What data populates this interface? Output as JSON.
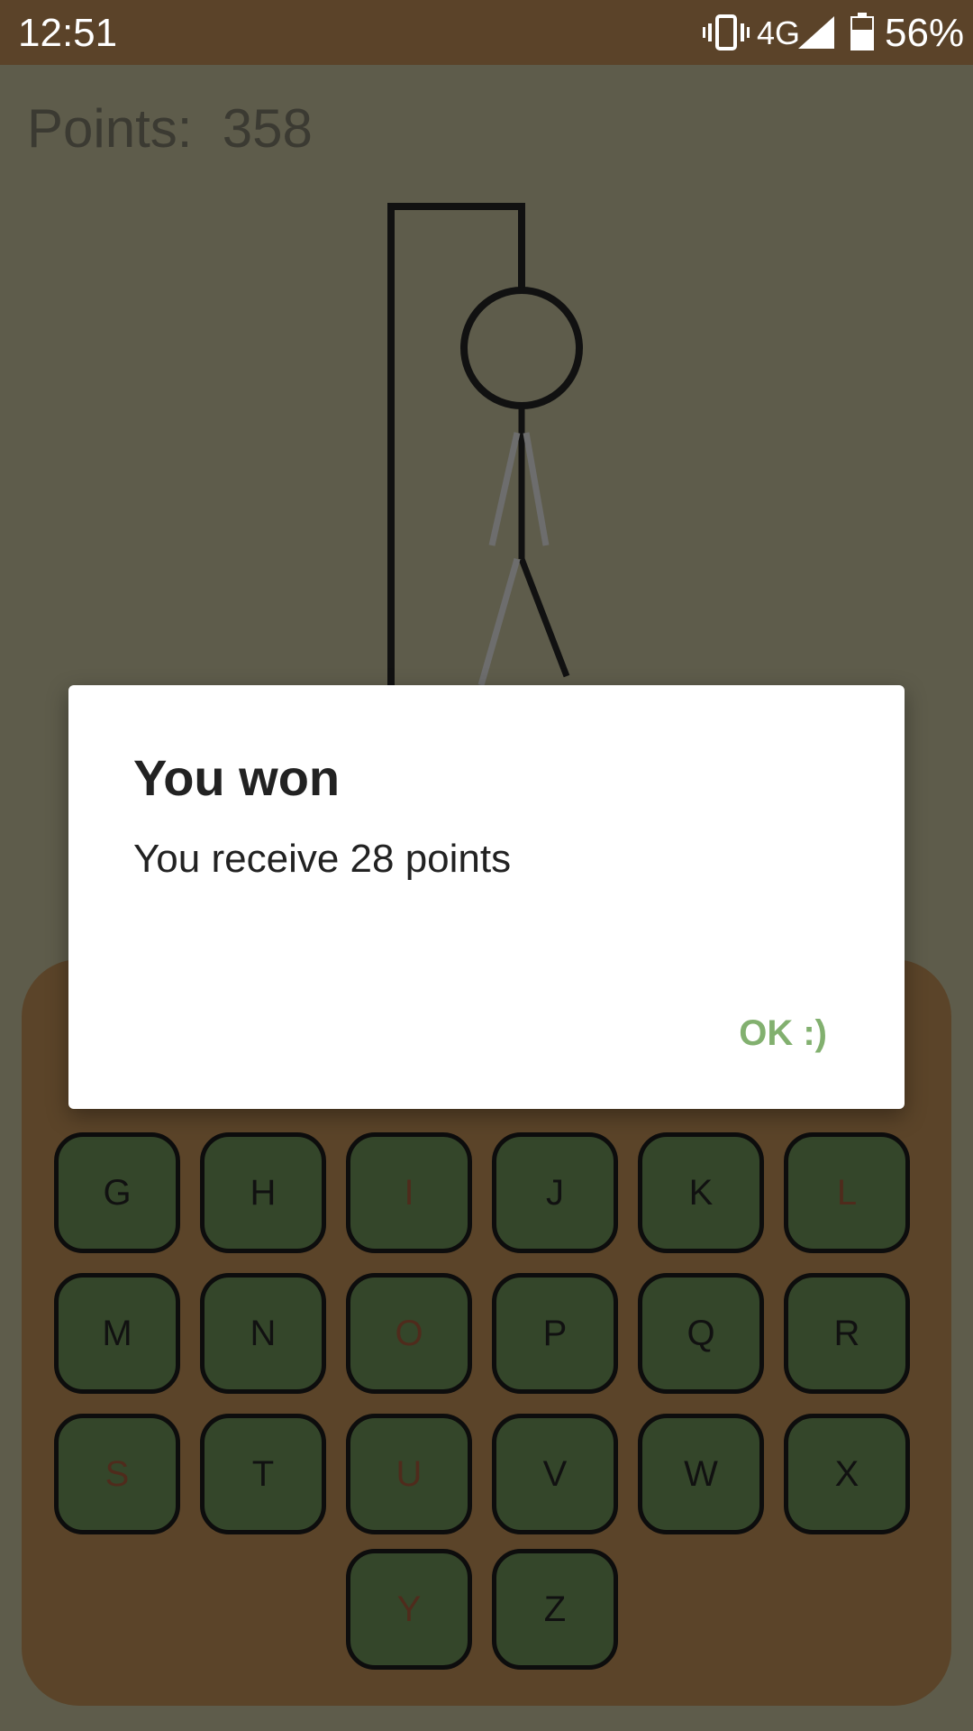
{
  "status_bar": {
    "time": "12:51",
    "network": "4G",
    "battery": "56%",
    "icons": [
      "vibrate-icon",
      "cell-signal-icon",
      "battery-icon"
    ]
  },
  "game": {
    "points_label": "Points:",
    "points_value": "358"
  },
  "keyboard": {
    "keys": [
      {
        "letter": "G",
        "used": false
      },
      {
        "letter": "H",
        "used": false
      },
      {
        "letter": "I",
        "used": true
      },
      {
        "letter": "J",
        "used": false
      },
      {
        "letter": "K",
        "used": false
      },
      {
        "letter": "L",
        "used": true
      },
      {
        "letter": "M",
        "used": false
      },
      {
        "letter": "N",
        "used": false
      },
      {
        "letter": "O",
        "used": true
      },
      {
        "letter": "P",
        "used": false
      },
      {
        "letter": "Q",
        "used": false
      },
      {
        "letter": "R",
        "used": false
      },
      {
        "letter": "S",
        "used": true
      },
      {
        "letter": "T",
        "used": false
      },
      {
        "letter": "U",
        "used": true
      },
      {
        "letter": "V",
        "used": false
      },
      {
        "letter": "W",
        "used": false
      },
      {
        "letter": "X",
        "used": false
      },
      {
        "letter": "Y",
        "used": true
      },
      {
        "letter": "Z",
        "used": false
      }
    ]
  },
  "dialog": {
    "title": "You won",
    "message": "You receive 28 points",
    "ok_label": "OK :)"
  },
  "colors": {
    "background": "#5e5c4b",
    "status_bar": "#5b4329",
    "key_fill": "#34462a",
    "used_letter": "#4f2b1c",
    "accent": "#82b06f"
  }
}
